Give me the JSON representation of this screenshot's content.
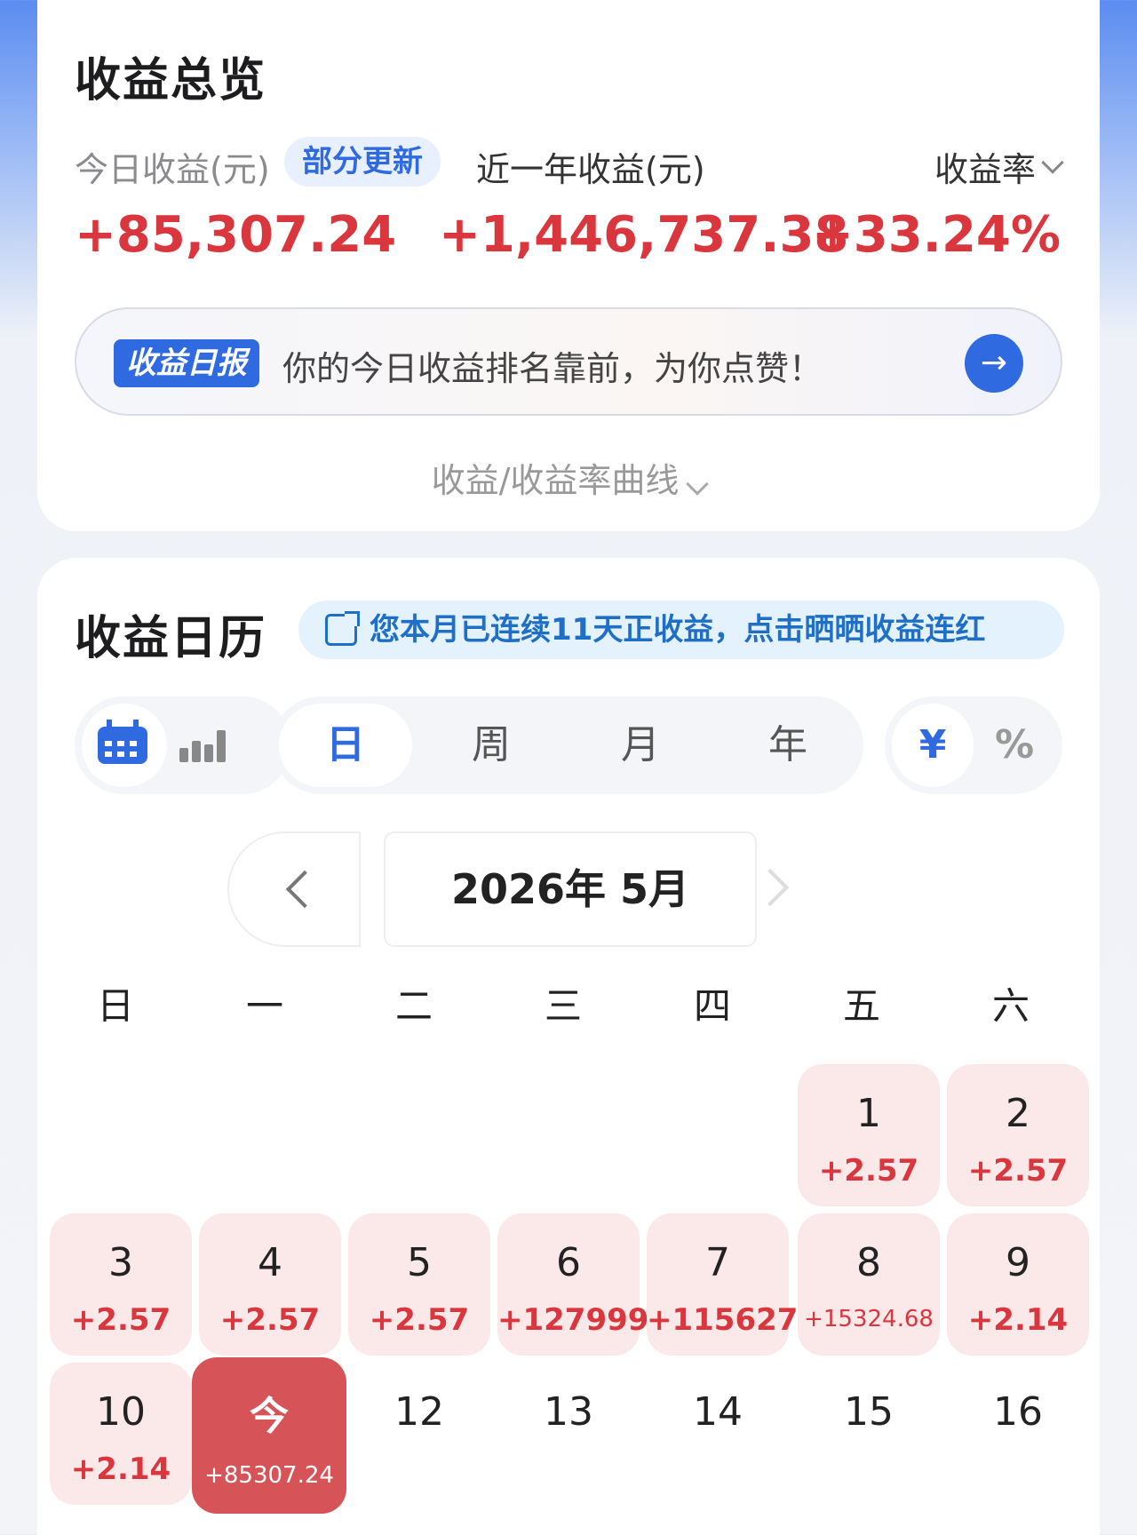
{
  "overview": {
    "title": "收益总览",
    "today_label": "今日收益(元)",
    "update_tag": "部分更新",
    "year_label": "近一年收益(元)",
    "rate_label": "收益率",
    "today_value": "+85,307.24",
    "year_value": "+1,446,737.38",
    "rate_value": "+33.24%",
    "banner_tag": "收益日报",
    "banner_text": "你的今日收益排名靠前，为你点赞！",
    "curve_toggle": "收益/收益率曲线"
  },
  "calendar": {
    "title": "收益日历",
    "streak_text": "您本月已连续11天正收益，点击晒晒收益连红",
    "periods": [
      "日",
      "周",
      "月",
      "年"
    ],
    "units": [
      "¥",
      "%"
    ],
    "month_label": "2026年 5月",
    "weekdays": [
      "日",
      "一",
      "二",
      "三",
      "四",
      "五",
      "六"
    ],
    "days": [
      {
        "num": "1",
        "value": "+2.57"
      },
      {
        "num": "2",
        "value": "+2.57"
      },
      {
        "num": "3",
        "value": "+2.57"
      },
      {
        "num": "4",
        "value": "+2.57"
      },
      {
        "num": "5",
        "value": "+2.57"
      },
      {
        "num": "6",
        "value": "+127999"
      },
      {
        "num": "7",
        "value": "+115627"
      },
      {
        "num": "8",
        "value": "+15324.68"
      },
      {
        "num": "9",
        "value": "+2.14"
      },
      {
        "num": "10",
        "value": "+2.14"
      },
      {
        "num": "今",
        "value": "+85307.24"
      },
      {
        "num": "12",
        "value": ""
      },
      {
        "num": "13",
        "value": ""
      },
      {
        "num": "14",
        "value": ""
      },
      {
        "num": "15",
        "value": ""
      },
      {
        "num": "16",
        "value": ""
      }
    ]
  },
  "colors": {
    "accent": "#2f6ae0",
    "gain": "#d9363e",
    "today": "#d65457",
    "gain_bg": "#fbe9ea"
  }
}
